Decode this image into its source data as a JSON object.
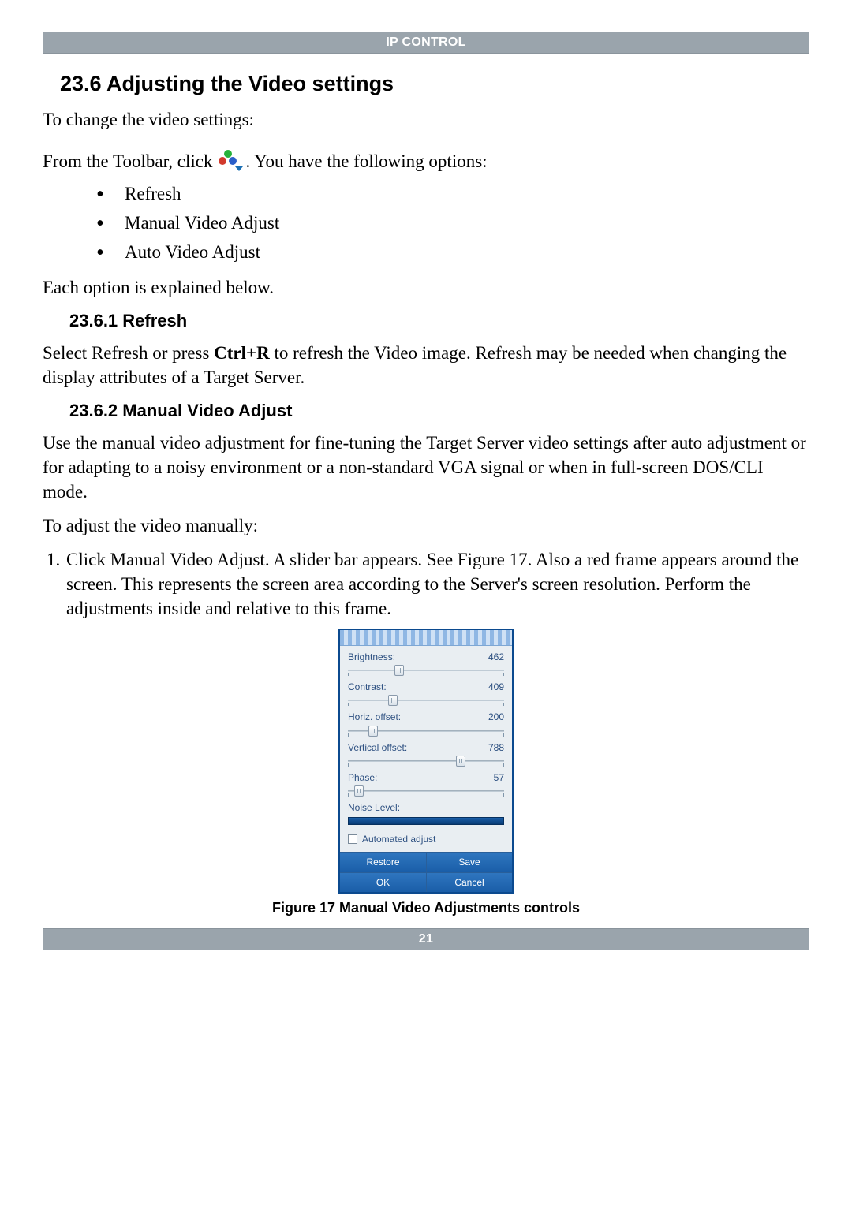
{
  "header": {
    "title": "IP CONTROL"
  },
  "section": {
    "h2": "23.6 Adjusting the Video settings",
    "intro": "To change the video settings:",
    "toolbar_pre": "From the Toolbar, click ",
    "toolbar_post": ". You have the following options:",
    "bullets": [
      "Refresh",
      "Manual Video Adjust",
      "Auto Video Adjust"
    ],
    "explained": "Each option is explained below."
  },
  "refresh": {
    "h3": "23.6.1 Refresh",
    "text_a": "Select Refresh or press ",
    "hotkey": "Ctrl+R",
    "text_b": " to refresh the Video image. Refresh may be needed when changing the display attributes of a Target Server."
  },
  "manual": {
    "h3": "23.6.2 Manual Video Adjust",
    "para": "Use the manual video adjustment for fine-tuning the Target Server video settings after auto adjustment or for adapting to a noisy environment or a non-standard VGA signal or when in full-screen DOS/CLI mode.",
    "lead": "To adjust the video manually:",
    "step1": "Click Manual Video Adjust. A slider bar appears. See Figure 17. Also a red frame appears around the screen. This represents the screen area according to the Server's screen resolution. Perform the adjustments inside and relative to this frame."
  },
  "dialog": {
    "brightness": {
      "label": "Brightness:",
      "value": "462",
      "pos": 33
    },
    "contrast": {
      "label": "Contrast:",
      "value": "409",
      "pos": 29
    },
    "horiz": {
      "label": "Horiz. offset:",
      "value": "200",
      "pos": 16
    },
    "vert": {
      "label": "Vertical offset:",
      "value": "788",
      "pos": 72
    },
    "phase": {
      "label": "Phase:",
      "value": "57",
      "pos": 7
    },
    "noise_label": "Noise Level:",
    "auto_label": "Automated adjust",
    "buttons": {
      "restore": "Restore",
      "save": "Save",
      "ok": "OK",
      "cancel": "Cancel"
    }
  },
  "figure_caption": "Figure 17 Manual Video Adjustments controls",
  "footer": {
    "page": "21"
  }
}
